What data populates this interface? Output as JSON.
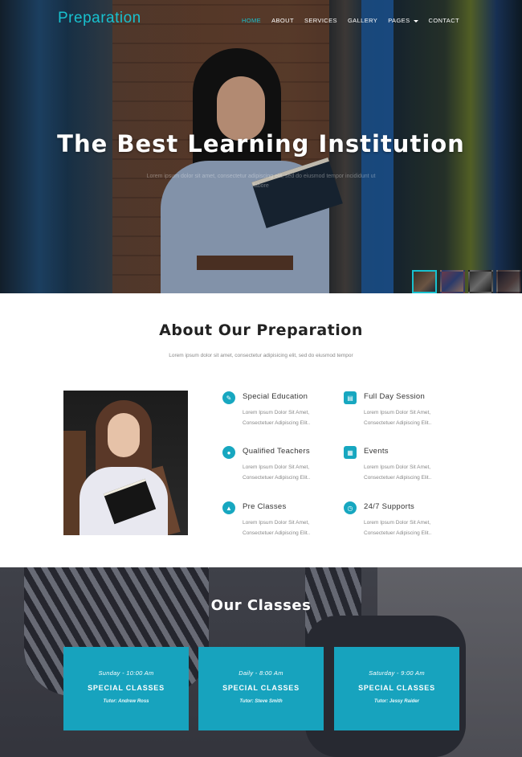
{
  "header": {
    "logo": "Preparation",
    "menu": [
      {
        "label": "HOME",
        "active": true
      },
      {
        "label": "ABOUT"
      },
      {
        "label": "SERVICES"
      },
      {
        "label": "GALLERY"
      },
      {
        "label": "PAGES",
        "dropdown": true
      },
      {
        "label": "CONTACT"
      }
    ]
  },
  "hero": {
    "title": "The Best Learning Institution",
    "subtitle": "Lorem ipsum dolor sit amet, consectetur adipiscing elit, sed do eiusmod tempor incididunt ut labore",
    "thumbnails_count": 4
  },
  "about": {
    "title": "About Our Preparation",
    "subtitle": "Lorem ipsum dolor sit amet, consectetur adipisicing elit, sed do eiusmod tempor",
    "features": [
      {
        "title": "Special Education",
        "line1": "Lorem Ipsum Dolor Sit Amet,",
        "line2": "Consectetuer Adipiscing Elit..",
        "icon": "pencil-icon"
      },
      {
        "title": "Full Day Session",
        "line1": "Lorem Ipsum Dolor Sit Amet,",
        "line2": "Consectetuer Adipiscing Elit..",
        "icon": "book-icon"
      },
      {
        "title": "Qualified Teachers",
        "line1": "Lorem Ipsum Dolor Sit Amet,",
        "line2": "Consectetuer Adipiscing Elit..",
        "icon": "user-icon"
      },
      {
        "title": "Events",
        "line1": "Lorem Ipsum Dolor Sit Amet,",
        "line2": "Consectetuer Adipiscing Elit..",
        "icon": "calendar-icon"
      },
      {
        "title": "Pre Classes",
        "line1": "Lorem Ipsum Dolor Sit Amet,",
        "line2": "Consectetuer Adipiscing Elit..",
        "icon": "graduation-icon"
      },
      {
        "title": "24/7 Supports",
        "line1": "Lorem Ipsum Dolor Sit Amet,",
        "line2": "Consectetuer Adipiscing Elit..",
        "icon": "clock-icon"
      }
    ]
  },
  "classes": {
    "title": "Our Classes",
    "cards": [
      {
        "time": "Sunday - 10:00 Am",
        "name": "SPECIAL CLASSES",
        "tutor": "Tutor: Andrew Ross"
      },
      {
        "time": "Daily - 8:00 Am",
        "name": "SPECIAL CLASSES",
        "tutor": "Tutor: Steve Smith"
      },
      {
        "time": "Saturday - 9:00 Am",
        "name": "SPECIAL CLASSES",
        "tutor": "Tutor: Jessy Raider"
      }
    ]
  },
  "colors": {
    "accent": "#18c1cf",
    "card": "#17a3be",
    "icon": "#17a7c0"
  }
}
